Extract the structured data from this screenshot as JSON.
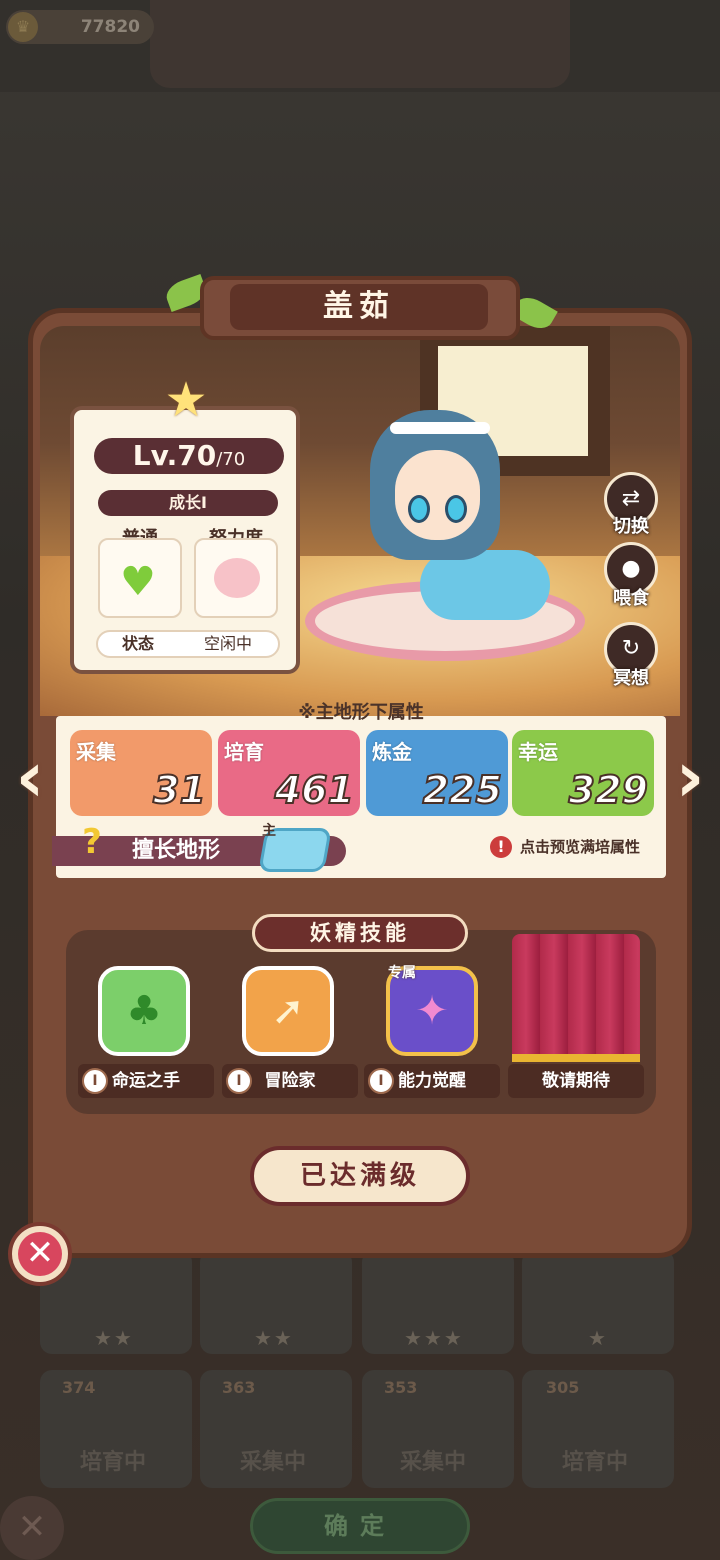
{
  "topbar": {
    "coin_value": "77820"
  },
  "character": {
    "name": "盖茹",
    "level": "Lv.70",
    "level_max": "/70",
    "growth": "成长I",
    "attr1_label": "普通",
    "attr2_label": "努力度",
    "status_key": "状态",
    "status_value": "空闲中"
  },
  "actions": [
    {
      "label": "切换",
      "icon": "switch-icon"
    },
    {
      "label": "喂食",
      "icon": "meat-icon"
    },
    {
      "label": "冥想",
      "icon": "meditate-icon"
    }
  ],
  "stats": {
    "header": "※主地形下属性",
    "items": [
      {
        "name": "采集",
        "value": "31",
        "color": "#f29a6a"
      },
      {
        "name": "培育",
        "value": "461",
        "color": "#e96a86"
      },
      {
        "name": "炼金",
        "value": "225",
        "color": "#4f9ad6"
      },
      {
        "name": "幸运",
        "value": "329",
        "color": "#8cc94a"
      }
    ],
    "terrain_label": "擅长地形",
    "terrain_main_tag": "主",
    "preview_hint": "点击预览满培属性"
  },
  "skills": {
    "title": "妖精技能",
    "exclusive_tag": "专属",
    "items": [
      {
        "label": "命运之手",
        "icon": "clover-icon"
      },
      {
        "label": "冒险家",
        "icon": "treasure-bag-icon"
      },
      {
        "label": "能力觉醒",
        "icon": "awaken-icon"
      },
      {
        "label": "敬请期待",
        "icon": "curtain-icon"
      }
    ]
  },
  "max_button": "已达满级",
  "background": {
    "cards": [
      {
        "stars": "★★",
        "level": "374",
        "status": "培育中"
      },
      {
        "stars": "★★",
        "level": "363",
        "status": "采集中"
      },
      {
        "stars": "★★★",
        "level": "353",
        "status": "采集中"
      },
      {
        "stars": "★",
        "level": "305",
        "status": "培育中"
      }
    ],
    "confirm_label": "确定"
  }
}
